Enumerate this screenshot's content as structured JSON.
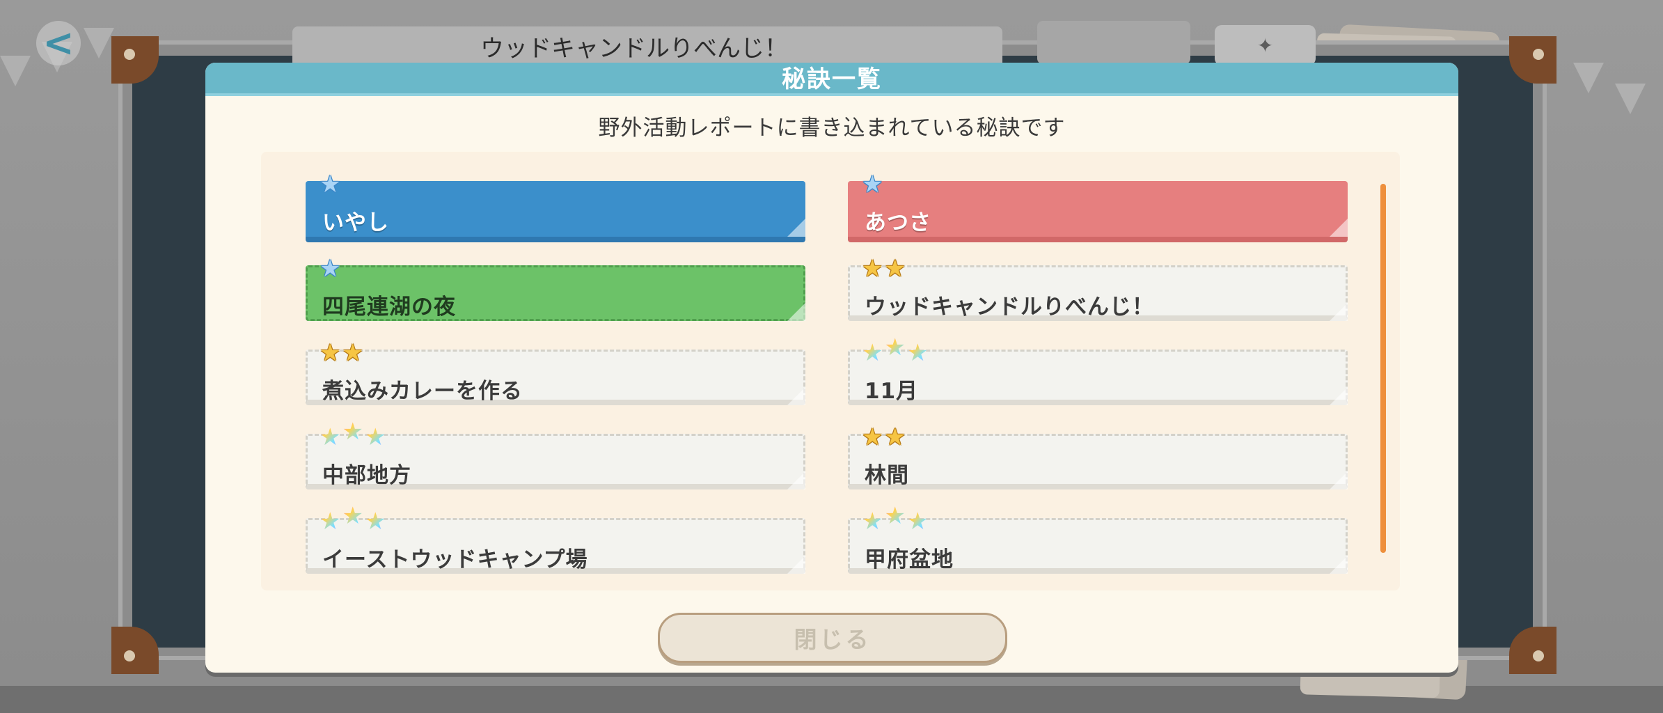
{
  "screen": {
    "back_icon_glyph": "<",
    "background_title": "ウッドキャンドルりべんじ！"
  },
  "modal": {
    "title": "秘訣一覧",
    "subtitle": "野外活動レポートに書き込まれている秘訣です",
    "close_label": "閉じる",
    "secrets": [
      {
        "name": "いやし",
        "stars": 1,
        "star_type": "blue",
        "style": "blue"
      },
      {
        "name": "あつさ",
        "stars": 1,
        "star_type": "blue",
        "style": "red"
      },
      {
        "name": "四尾連湖の夜",
        "stars": 1,
        "star_type": "blue",
        "style": "green"
      },
      {
        "name": "ウッドキャンドルりべんじ！",
        "stars": 2,
        "star_type": "gold",
        "style": "plain"
      },
      {
        "name": "煮込みカレーを作る",
        "stars": 2,
        "star_type": "gold",
        "style": "plain"
      },
      {
        "name": "11月",
        "stars": 3,
        "star_type": "rainbow",
        "style": "plain"
      },
      {
        "name": "中部地方",
        "stars": 3,
        "star_type": "rainbow",
        "style": "plain"
      },
      {
        "name": "林間",
        "stars": 2,
        "star_type": "gold",
        "style": "plain"
      },
      {
        "name": "イーストウッドキャンプ場",
        "stars": 3,
        "star_type": "rainbow",
        "style": "plain"
      },
      {
        "name": "甲府盆地",
        "stars": 3,
        "star_type": "rainbow",
        "style": "plain"
      }
    ]
  },
  "colors": {
    "header": "#6ab8c9",
    "card_blue": "#3b8fcb",
    "card_red": "#e67f7f",
    "card_green": "#6cc268",
    "scroll_thumb": "#ee8f3c"
  }
}
